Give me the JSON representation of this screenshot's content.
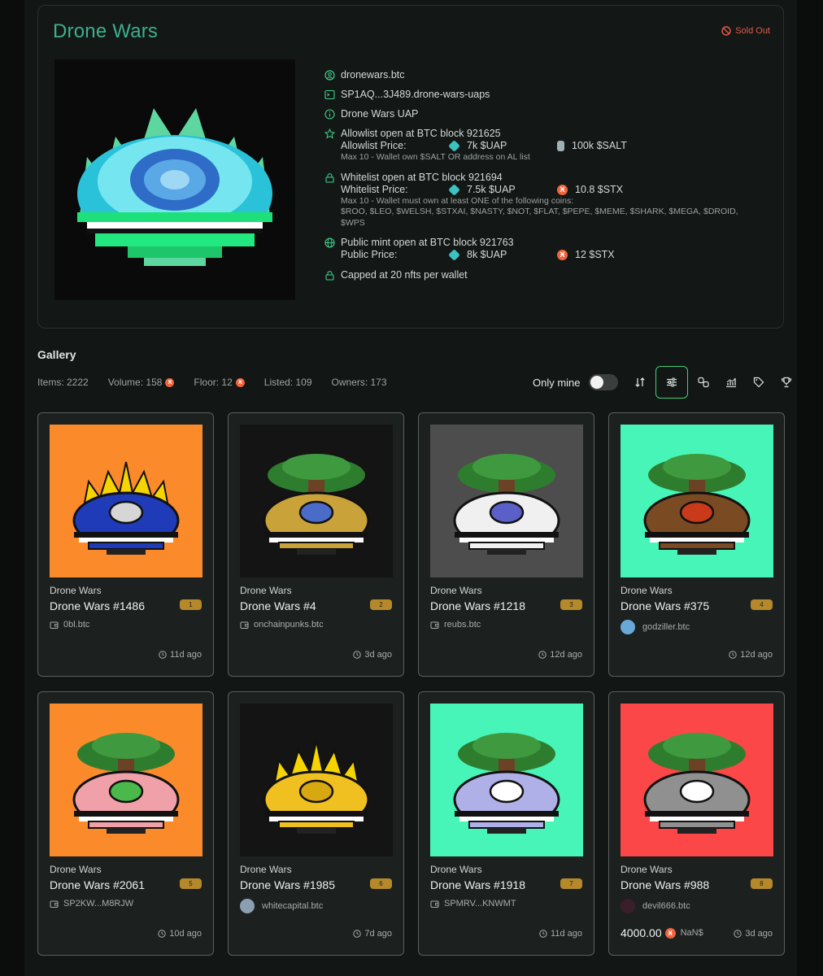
{
  "collection": {
    "title": "Drone Wars",
    "status": "Sold Out",
    "info": {
      "btc_name": "dronewars.btc",
      "contract": "SP1AQ...3J489.drone-wars-uaps",
      "name": "Drone Wars UAP",
      "allowlist": {
        "title": "Allowlist open at BTC block 921625",
        "price_label": "Allowlist Price:",
        "price_a": "7k $UAP",
        "price_b": "100k $SALT",
        "note": "Max 10 - Wallet own $SALT OR address on AL list"
      },
      "whitelist": {
        "title": "Whitelist open at BTC block 921694",
        "price_label": "Whitelist Price:",
        "price_a": "7.5k $UAP",
        "price_b": "10.8 $STX",
        "note": "Max 10 - Wallet must own at least ONE of the following coins:",
        "coins": "$ROO, $LEO, $WELSH, $STXAI, $NASTY, $NOT, $FLAT, $PEPE, $MEME, $SHARK, $MEGA, $DROID, $WPS"
      },
      "public": {
        "title": "Public mint open at BTC block 921763",
        "price_label": "Public Price:",
        "price_a": "8k $UAP",
        "price_b": "12 $STX"
      },
      "cap": "Capped at 20 nfts per wallet"
    }
  },
  "gallery": {
    "title": "Gallery",
    "stats": {
      "items": "Items: 2222",
      "volume": "Volume: 158",
      "floor": "Floor: 12",
      "listed": "Listed: 109",
      "owners": "Owners: 173"
    },
    "only_mine_label": "Only mine",
    "stx_symbol": "Ӿ"
  },
  "nfts": [
    {
      "collection": "Drone Wars",
      "name": "Drone Wars #1486",
      "rank": "1",
      "owner": "0bl.btc",
      "time": "11d ago",
      "bg": "#fb8a2b"
    },
    {
      "collection": "Drone Wars",
      "name": "Drone Wars #4",
      "rank": "2",
      "owner": "onchainpunks.btc",
      "time": "3d ago",
      "bg": "#141414"
    },
    {
      "collection": "Drone Wars",
      "name": "Drone Wars #1218",
      "rank": "3",
      "owner": "reubs.btc",
      "time": "12d ago",
      "bg": "#4d4d4d"
    },
    {
      "collection": "Drone Wars",
      "name": "Drone Wars #375",
      "rank": "4",
      "owner": "godziller.btc",
      "time": "12d ago",
      "bg": "#47f5b8"
    },
    {
      "collection": "Drone Wars",
      "name": "Drone Wars #2061",
      "rank": "5",
      "owner": "SP2KW...M8RJW",
      "time": "10d ago",
      "bg": "#fb8a2b"
    },
    {
      "collection": "Drone Wars",
      "name": "Drone Wars #1985",
      "rank": "6",
      "owner": "whitecapital.btc",
      "time": "7d ago",
      "bg": "#141414"
    },
    {
      "collection": "Drone Wars",
      "name": "Drone Wars #1918",
      "rank": "7",
      "owner": "SPMRV...KNWMT",
      "time": "11d ago",
      "bg": "#47f5b8"
    },
    {
      "collection": "Drone Wars",
      "name": "Drone Wars #988",
      "rank": "8",
      "owner": "devil666.btc",
      "time": "3d ago",
      "bg": "#fb4747",
      "price": "4000.00",
      "usd": "NaN$"
    }
  ]
}
